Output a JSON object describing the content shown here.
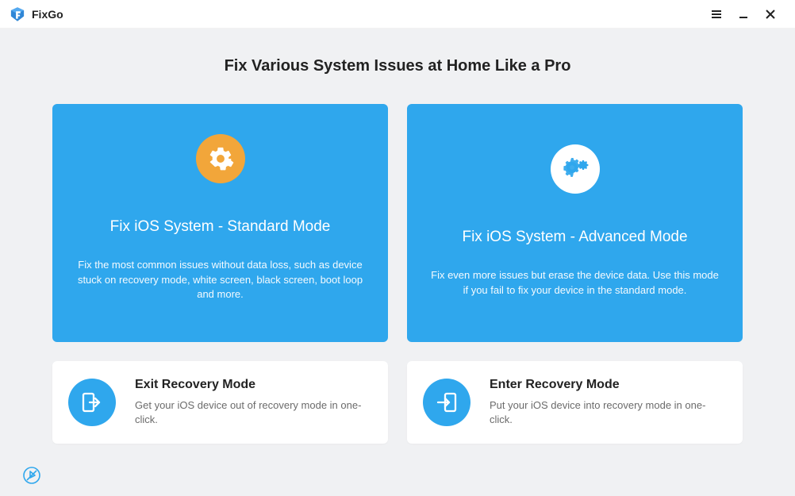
{
  "app": {
    "title": "FixGo"
  },
  "titlebar": {
    "menu_icon": "menu",
    "minimize_icon": "minimize",
    "close_icon": "close"
  },
  "heading": "Fix Various System Issues at Home Like a Pro",
  "cards": {
    "standard": {
      "title": "Fix iOS System - Standard Mode",
      "desc": "Fix the most common issues without data loss, such as device stuck on recovery mode, white screen, black screen, boot loop and more."
    },
    "advanced": {
      "title": "Fix iOS System - Advanced Mode",
      "desc": "Fix even more issues but erase the device data. Use this mode if you fail to fix your device in the standard mode."
    },
    "exit": {
      "title": "Exit Recovery Mode",
      "desc": "Get your iOS device out of recovery mode in one-click."
    },
    "enter": {
      "title": "Enter Recovery Mode",
      "desc": "Put your iOS device into recovery mode in one-click."
    }
  },
  "footer": {
    "feedback_icon": "feedback"
  }
}
